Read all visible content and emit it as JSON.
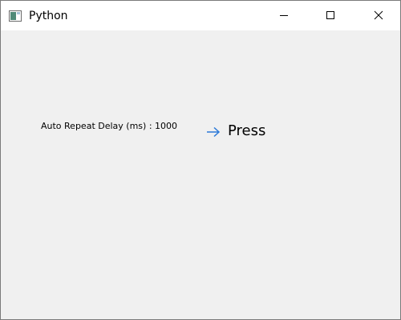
{
  "window": {
    "title": "Python",
    "app_icon": "python-window-icon",
    "controls": {
      "minimize_icon": "minimize-icon",
      "maximize_icon": "maximize-icon",
      "close_icon": "close-icon"
    }
  },
  "content": {
    "delay_label": "Auto Repeat Delay (ms) : 1000",
    "press_button": {
      "label": "Press",
      "icon": "arrow-right-icon",
      "icon_color": "#2b79d8"
    }
  }
}
